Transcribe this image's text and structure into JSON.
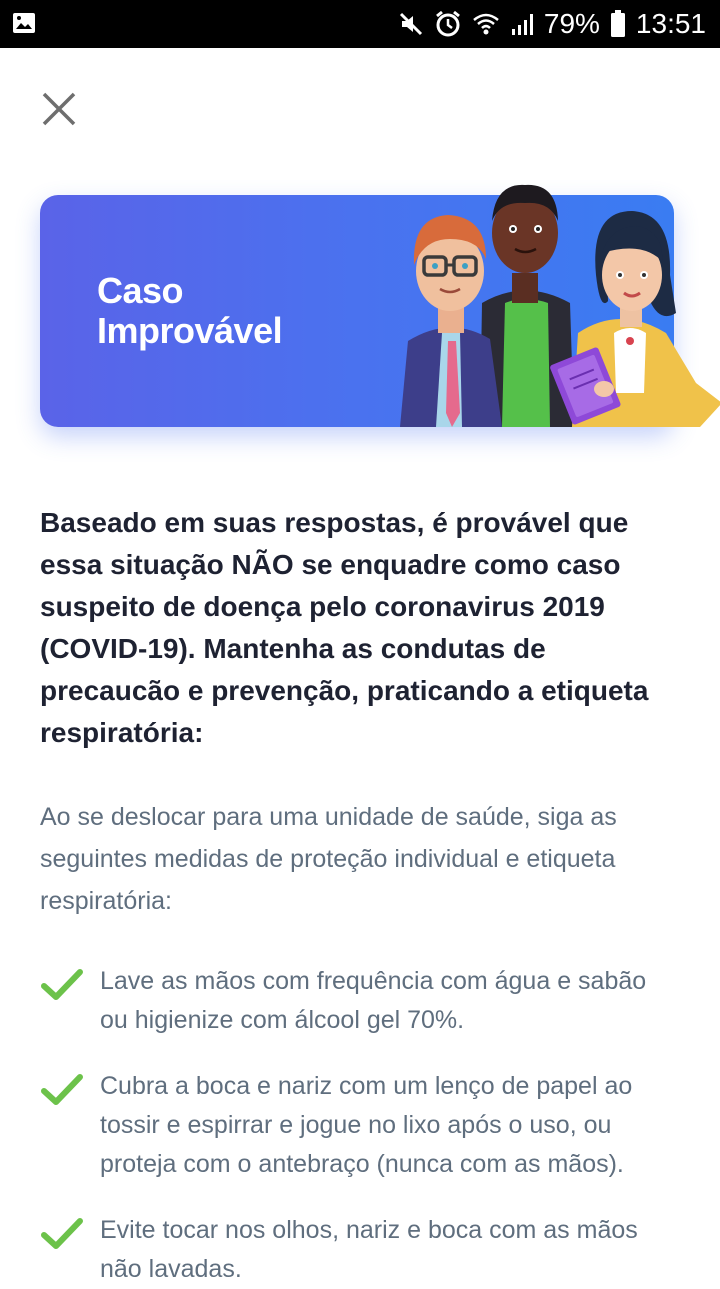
{
  "status_bar": {
    "battery": "79%",
    "time": "13:51"
  },
  "banner": {
    "title": "Caso\nImprovável"
  },
  "lead_text": "Baseado em suas respostas, é provável que essa situação NÃO se enquadre como caso suspeito de doença pelo coronavirus 2019 (COVID-19). Mantenha as condutas de precaucão e prevenção, praticando a etiqueta respiratória:",
  "intro_text": "Ao se deslocar para uma unidade de saúde, siga as seguintes medidas de proteção individual e etiqueta respiratória:",
  "items": [
    {
      "text": "Lave as mãos com frequência com água e sabão ou higienize com álcool gel 70%."
    },
    {
      "text": "Cubra a boca e nariz com um lenço de papel ao tossir e espirrar e jogue no lixo após o uso, ou proteja com o antebraço (nunca com as mãos)."
    },
    {
      "text": "Evite tocar nos olhos, nariz e boca com as mãos não lavadas."
    }
  ],
  "colors": {
    "accent_green": "#6cc24a",
    "banner_blue": "#4a72ef"
  },
  "icons": [
    "gallery-icon",
    "mute-icon",
    "alarm-icon",
    "wifi-icon",
    "signal-icon",
    "battery-icon",
    "close-icon",
    "check-icon"
  ]
}
